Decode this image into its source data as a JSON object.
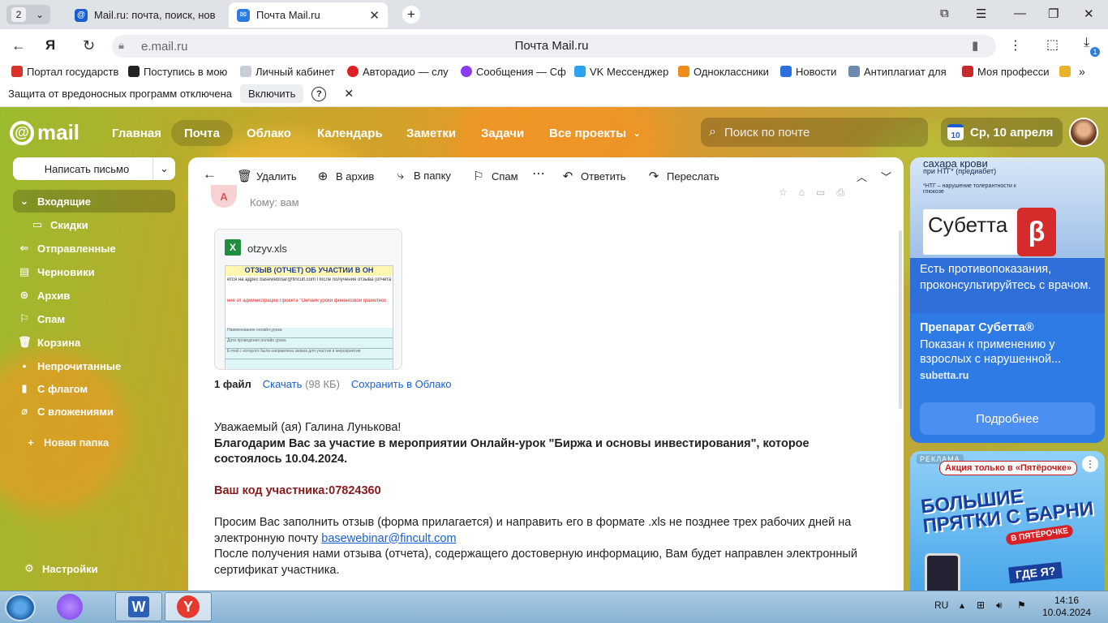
{
  "browser": {
    "tab_count": "2",
    "tabs": [
      {
        "title": "Mail.ru: почта, поиск, нов"
      },
      {
        "title": "Почта Mail.ru"
      }
    ],
    "address_host": "e.mail.ru",
    "page_title": "Почта Mail.ru",
    "downloads_badge": "1",
    "bookmarks": [
      {
        "label": "Портал государств",
        "color": "#d8332b"
      },
      {
        "label": "Поступись в мою",
        "color": "#222222"
      },
      {
        "label": "Личный кабинет",
        "color": "#c9ced6"
      },
      {
        "label": "Авторадио — слу",
        "color": "#e02020"
      },
      {
        "label": "Сообщения — Сф",
        "color": "#8a3cf0"
      },
      {
        "label": "VK Мессенджер",
        "color": "#2aa3f0"
      },
      {
        "label": "Одноклассники",
        "color": "#f08a18"
      },
      {
        "label": "Новости",
        "color": "#2a6fe0"
      },
      {
        "label": "Антиплагиат для",
        "color": "#6a8ab0"
      },
      {
        "label": "Моя професси",
        "color": "#c42a2a"
      }
    ],
    "protection_text": "Защита от вредоносных программ отключена",
    "enable_label": "Включить"
  },
  "mail": {
    "logo_text": "mail",
    "nav": [
      "Главная",
      "Почта",
      "Облако",
      "Календарь",
      "Заметки",
      "Задачи",
      "Все проекты"
    ],
    "search_placeholder": "Поиск по почте",
    "calendar_day": "10",
    "date_text": "Ср, 10 апреля",
    "compose_label": "Написать письмо",
    "folders": [
      {
        "label": "Входящие",
        "icon": "chevron-down-icon"
      },
      {
        "label": "Скидки",
        "icon": "folder-icon"
      },
      {
        "label": "Отправленные",
        "icon": "sent-icon"
      },
      {
        "label": "Черновики",
        "icon": "draft-icon"
      },
      {
        "label": "Архив",
        "icon": "archive-icon"
      },
      {
        "label": "Спам",
        "icon": "spam-icon"
      },
      {
        "label": "Корзина",
        "icon": "trash-icon"
      },
      {
        "label": "Непрочитанные",
        "icon": "dot-icon"
      },
      {
        "label": "С флагом",
        "icon": "flag-icon"
      },
      {
        "label": "С вложениями",
        "icon": "paperclip-icon"
      }
    ],
    "new_folder": "Новая папка",
    "settings": "Настройки",
    "toolbar": {
      "delete": "Удалить",
      "archive": "В архив",
      "to_folder": "В папку",
      "spam": "Спам",
      "reply": "Ответить",
      "forward": "Переслать"
    }
  },
  "message": {
    "sender_initial": "А",
    "to_line": "Кому: вам",
    "attachment": {
      "filename": "otzyv.xls",
      "preview_title": "ОТЗЫВ (ОТЧЕТ) ОБ УЧАСТИИ В ОН",
      "preview_line1": "ется на адрес basewebinar@fincult.com После получения отзыва (отчета",
      "preview_line2": "ние от администрации Проекта \"Онлайн уроки финансовой грамотнос",
      "preview_rows": [
        "Наименование онлайн-урока",
        "Дата проведения онлайн урока",
        "E-mail с которого была направлена заявка для участия в мероприятии"
      ]
    },
    "files_count": "1 файл",
    "download": "Скачать",
    "size": "(98 КБ)",
    "save_cloud": "Сохранить в Облако",
    "greeting": "Уважаемый (ая) Галина Лунькова!",
    "thanks": "Благодарим Вас за участие в мероприятии Онлайн-урок \"Биржа и основы инвестирования\", которое состоялось 10.04.2024.",
    "code": "Ваш код участника:07824360",
    "request": "Просим Вас заполнить отзыв (форма прилагается) и направить его в формате .xls не позднее трех рабочих дней на электронную почту",
    "email": "basewebinar@fincult.com",
    "after": "После получения нами отзыва (отчета), содержащего достоверную информацию, Вам будет направлен электронный сертификат участника."
  },
  "ads": {
    "ad1": {
      "top_text": "сахара крови",
      "top_sub": "при НТГ* (предиабет)",
      "note": "*НТГ – нарушение толерантности к глюкозе",
      "box_text": "Субетта",
      "warning": "Есть противопоказания, проконсультируйтесь с врачом.",
      "title": "Препарат Субетта®",
      "desc": "Показан к применению у взрослых с нарушенной...",
      "domain": "subetta.ru",
      "button": "Подробнее"
    },
    "ad2": {
      "label": "РЕКЛАМА",
      "promo": "Акция только в «Пятёрочке»",
      "headline": "БОЛЬШИЕ ПРЯТКИ С БАРНИ",
      "sub": "В ПЯТЁРОЧКЕ",
      "where": "ГДЕ Я?"
    }
  },
  "taskbar": {
    "lang": "RU",
    "time": "14:16",
    "date": "10.04.2024"
  }
}
